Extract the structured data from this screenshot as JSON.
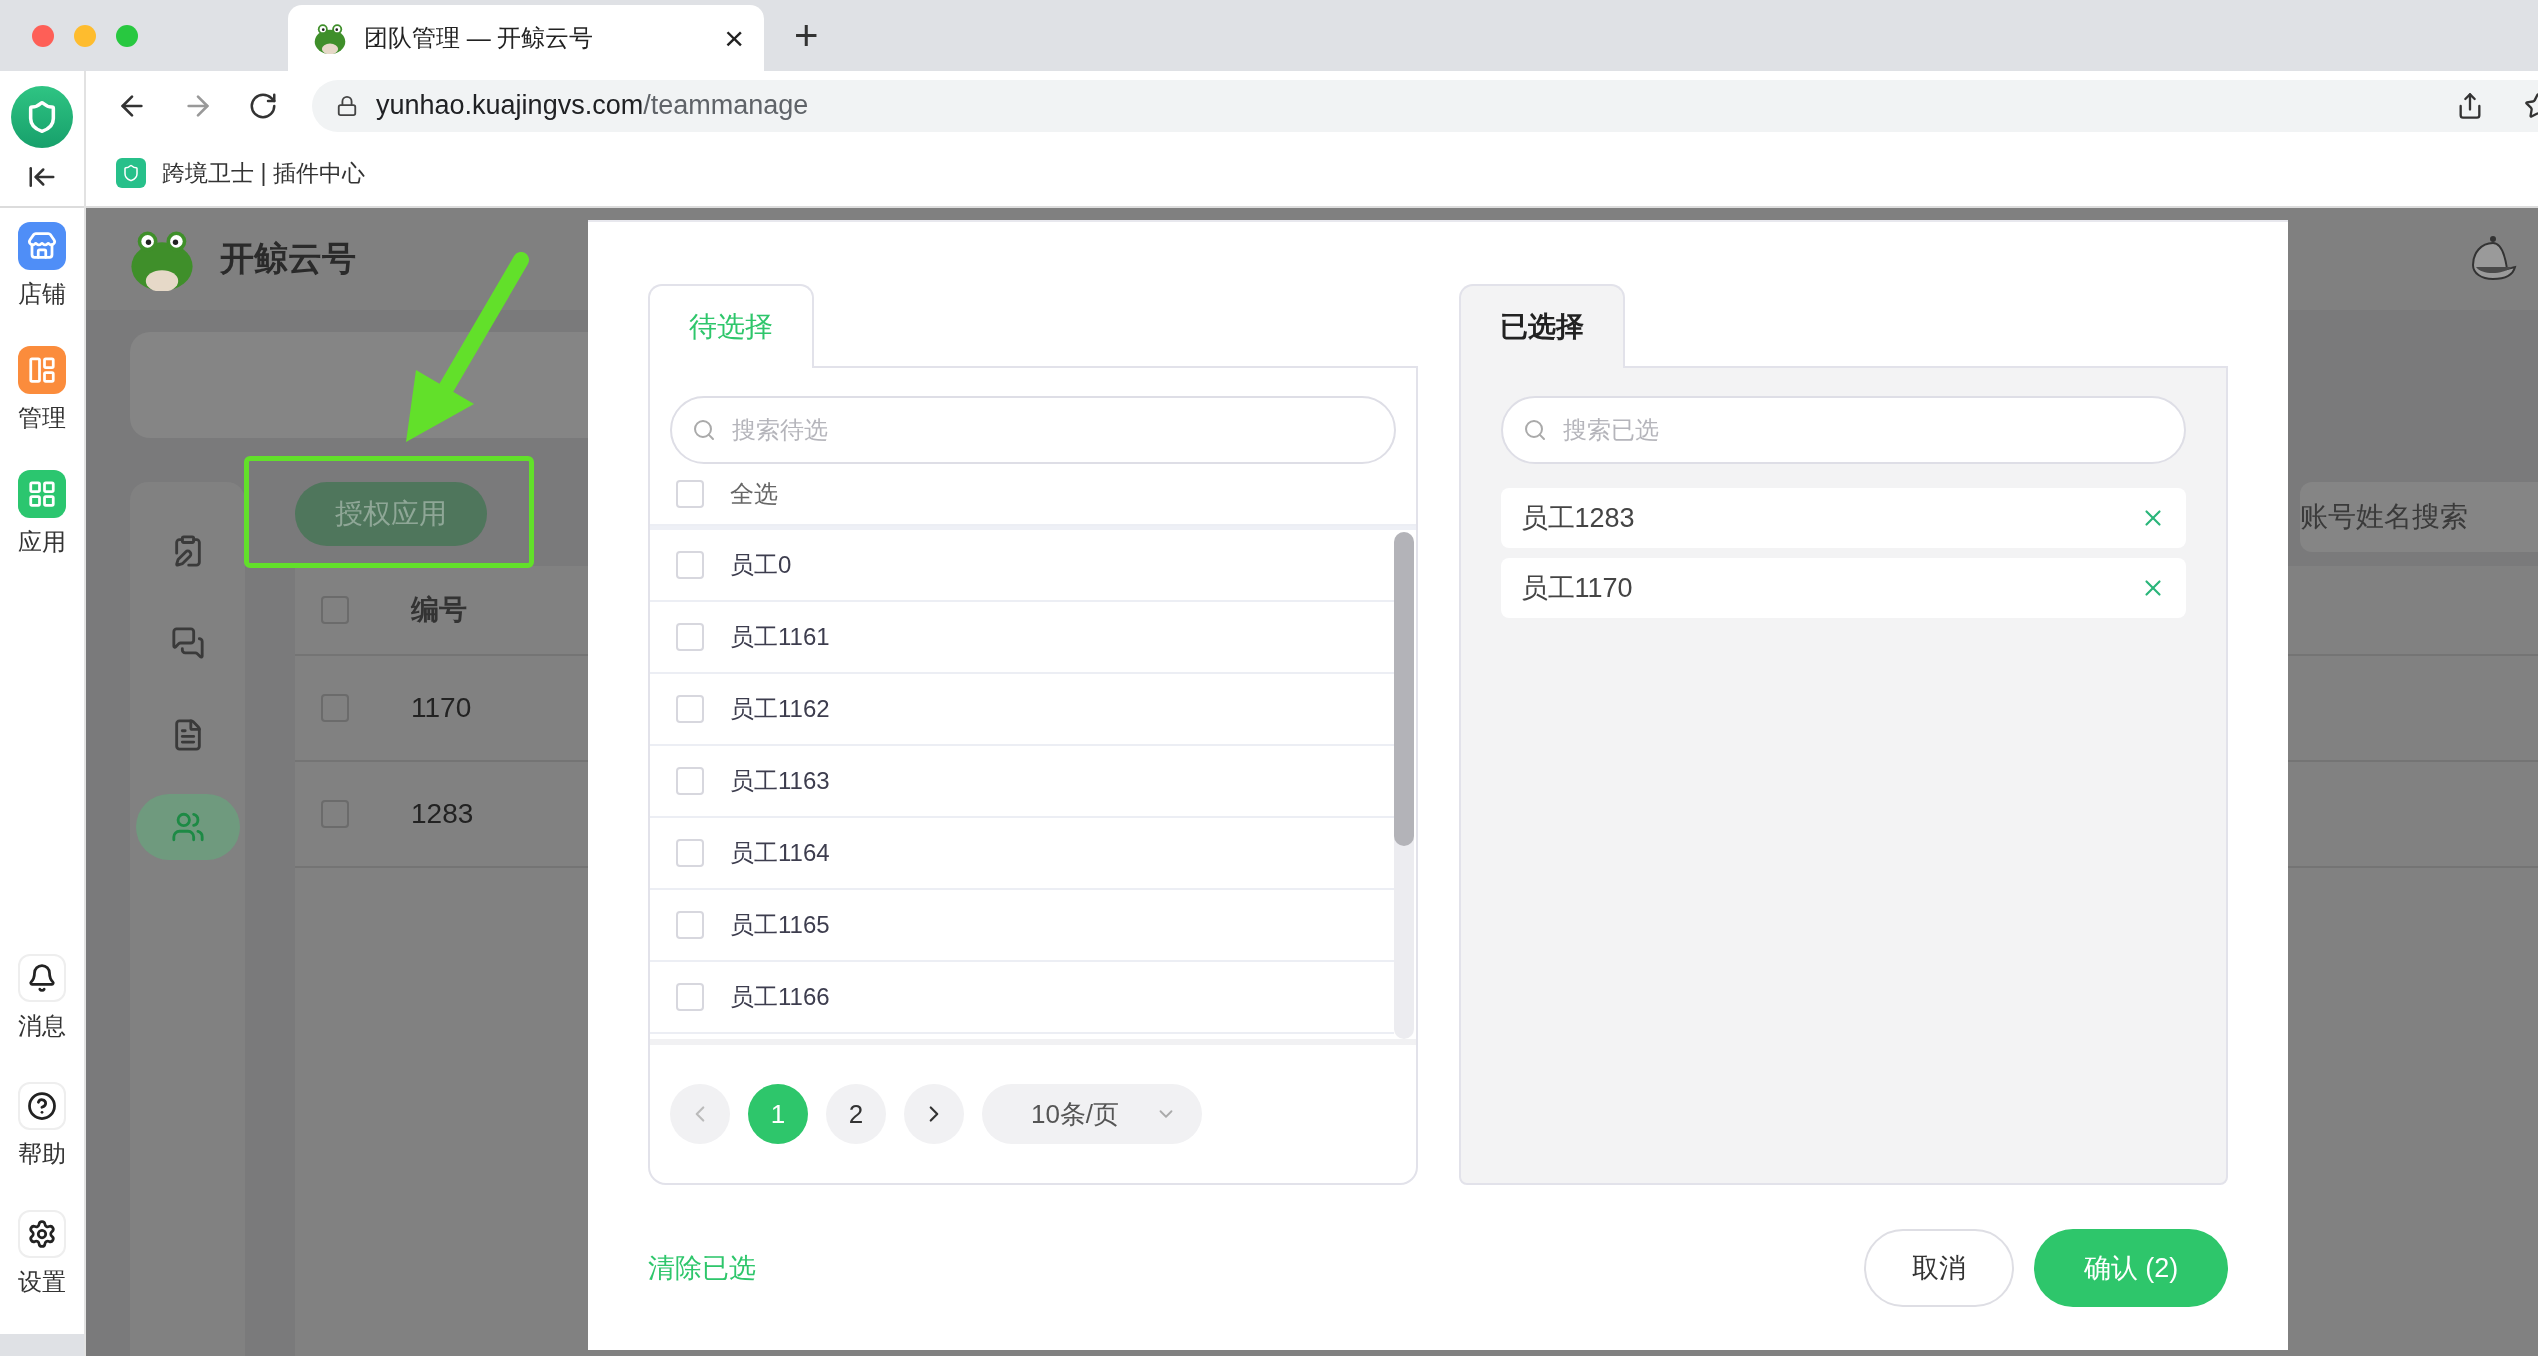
{
  "browser": {
    "tab_title": "团队管理 — 开鲸云号",
    "tab_close": "×",
    "new_tab": "+",
    "url_host": "yunhao.kuajingvs.com",
    "url_path": "/teammanage",
    "bookmark": "跨境卫士 | 插件中心"
  },
  "app_sidebar": {
    "items": [
      {
        "label": "店铺",
        "kind": "store"
      },
      {
        "label": "管理",
        "kind": "manage"
      },
      {
        "label": "应用",
        "kind": "apps"
      }
    ],
    "bottom_items": [
      {
        "label": "消息",
        "kind": "bell"
      },
      {
        "label": "帮助",
        "kind": "help"
      },
      {
        "label": "设置",
        "kind": "settings"
      }
    ]
  },
  "page": {
    "brand": "开鲸云号",
    "authorize_button": "授权应用",
    "nav": [
      {
        "kind": "clipboard",
        "selected": false
      },
      {
        "kind": "chat",
        "selected": false
      },
      {
        "kind": "document",
        "selected": false
      },
      {
        "kind": "users",
        "selected": true
      }
    ],
    "search_placeholder": "账号姓名搜索",
    "table": {
      "header_checked": false,
      "columns": [
        "编号"
      ],
      "rows": [
        {
          "cells": [
            "1170"
          ],
          "checked": false
        },
        {
          "cells": [
            "1283"
          ],
          "checked": false
        }
      ]
    }
  },
  "dialog": {
    "left_tab": "待选择",
    "left_search_placeholder": "搜索待选",
    "select_all": {
      "label": "全选",
      "checked": false
    },
    "candidates": [
      {
        "label": "员工0",
        "checked": false
      },
      {
        "label": "员工1161",
        "checked": false
      },
      {
        "label": "员工1162",
        "checked": false
      },
      {
        "label": "员工1163",
        "checked": false
      },
      {
        "label": "员工1164",
        "checked": false
      },
      {
        "label": "员工1165",
        "checked": false
      },
      {
        "label": "员工1166",
        "checked": false
      }
    ],
    "pagination": {
      "pages": [
        {
          "label": "1",
          "selected": true
        },
        {
          "label": "2",
          "selected": false
        }
      ],
      "page_size": "10条/页"
    },
    "right_tab": "已选择",
    "right_search_placeholder": "搜索已选",
    "selected_items": [
      "员工1283",
      "员工1170"
    ],
    "clear_link": "清除已选",
    "cancel": "取消",
    "confirm": "确认 (2)"
  }
}
